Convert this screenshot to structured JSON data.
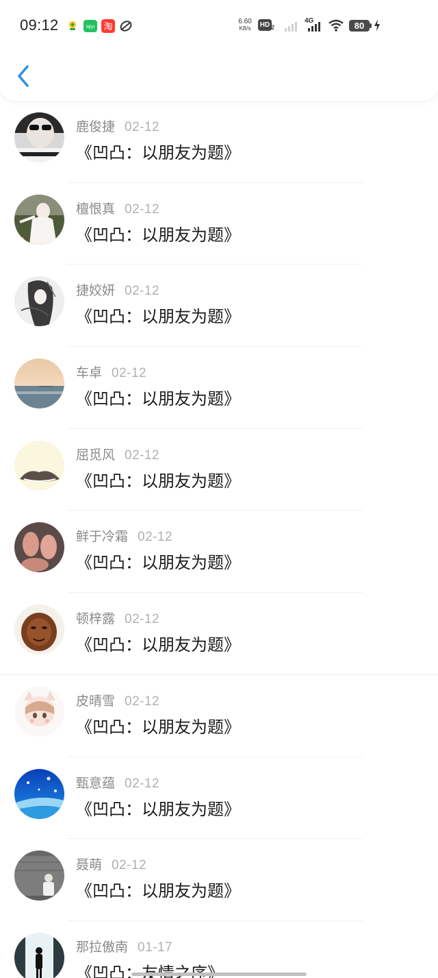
{
  "status_bar": {
    "time": "09:12",
    "net_speed_value": "6.60",
    "net_speed_unit": "KB/s",
    "hd_label": "HD",
    "hd_sub": "2",
    "network_type": "4G",
    "battery": "80",
    "app_icons": [
      "weather-app-icon",
      "iqiyi-app-icon",
      "taobao-app-icon",
      "link-app-icon"
    ]
  },
  "header": {
    "back_icon": "chevron-left-icon",
    "accent_color": "#2b8fe6"
  },
  "items": [
    {
      "name": "鹿俊捷",
      "date": "02-12",
      "title": "《凹凸：以朋友为题》",
      "avatar": "boy-sunglasses"
    },
    {
      "name": "檀恨真",
      "date": "02-12",
      "title": "《凹凸：以朋友为题》",
      "avatar": "girl-field"
    },
    {
      "name": "捷姣妍",
      "date": "02-12",
      "title": "《凹凸：以朋友为题》",
      "avatar": "ink-girl"
    },
    {
      "name": "车卓",
      "date": "02-12",
      "title": "《凹凸：以朋友为题》",
      "avatar": "sunset-sea"
    },
    {
      "name": "屈觅风",
      "date": "02-12",
      "title": "《凹凸：以朋友为题》",
      "avatar": "sleeping-cat"
    },
    {
      "name": "鲜于冷霜",
      "date": "02-12",
      "title": "《凹凸：以朋友为题》",
      "avatar": "baby-feet"
    },
    {
      "name": "顿梓露",
      "date": "02-12",
      "title": "《凹凸：以朋友为题》",
      "avatar": "buddha-statue"
    },
    {
      "name": "皮晴雪",
      "date": "02-12",
      "title": "《凹凸：以朋友为题》",
      "avatar": "anime-cat-girl"
    },
    {
      "name": "甄意蕴",
      "date": "02-12",
      "title": "《凹凸：以朋友为题》",
      "avatar": "blue-snowflakes"
    },
    {
      "name": "聂萌",
      "date": "02-12",
      "title": "《凹凸：以朋友为题》",
      "avatar": "boy-gray-wall"
    },
    {
      "name": "那拉傲南",
      "date": "01-17",
      "title": "《凹凸：友情之序》",
      "avatar": "silhouette-light"
    }
  ]
}
